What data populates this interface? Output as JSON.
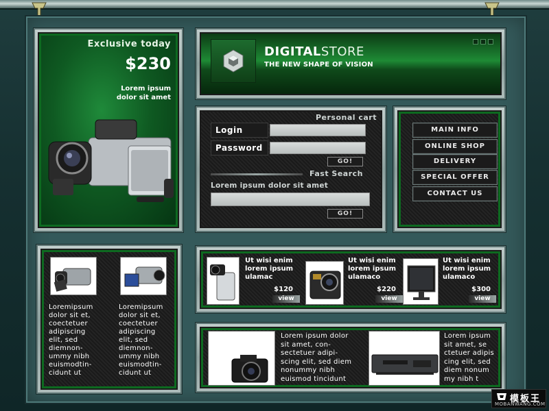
{
  "promo": {
    "title": "Exclusive today",
    "price": "$230",
    "desc_line1": "Lorem ipsum",
    "desc_line2": "dolor sit amet"
  },
  "header": {
    "brand_bold": "DIGITAL",
    "brand_light": "STORE",
    "tagline": "THE NEW SHAPE OF  VISION"
  },
  "cart": {
    "caption": "Personal cart",
    "login_label": "Login",
    "password_label": "Password",
    "login_value": "",
    "password_value": "",
    "go_label": "GO!"
  },
  "search": {
    "caption": "Fast Search",
    "prompt": "Lorem ipsum dolor sit amet",
    "value": "",
    "go_label": "GO!"
  },
  "menu": {
    "items": [
      {
        "label": "MAIN INFO"
      },
      {
        "label": "ONLINE SHOP"
      },
      {
        "label": "DELIVERY"
      },
      {
        "label": "SPECIAL OFFER"
      },
      {
        "label": "CONTACT US"
      }
    ]
  },
  "left_products": [
    {
      "text_lines": [
        "Loremipsum",
        "dolor sit et,",
        "coectetuer",
        "adipiscing",
        "elit, sed",
        "diemnon-",
        "ummy nibh",
        "euismodtin-",
        "cidunt ut"
      ]
    },
    {
      "text_lines": [
        "Loremipsum",
        "dolor sit et,",
        "coectetuer",
        "adipiscing",
        "elit, sed",
        "diemnon-",
        "ummy nibh",
        "euismodtin-",
        "cidunt ut"
      ]
    }
  ],
  "featured": [
    {
      "title_lines": [
        "Ut wisi enim",
        "lorem ipsum",
        "ulamac"
      ],
      "price": "$120",
      "view_label": "view"
    },
    {
      "title_lines": [
        "Ut wisi enim",
        "lorem ipsum",
        "ulamaco"
      ],
      "price": "$220",
      "view_label": "view"
    },
    {
      "title_lines": [
        "Ut wisi enim",
        "lorem ipsum",
        "ulamaco"
      ],
      "price": "$300",
      "view_label": "view"
    }
  ],
  "bottom": {
    "text1_lines": [
      "Lorem ipsum dolor",
      "sit amet, con-",
      "sectetuer adipi-",
      "scing elit, sed diem",
      "nonummy nibh",
      "euismod tincidunt"
    ],
    "text2_lines": [
      "Lorem ipsum",
      " sit amet, se",
      "ctetuer adipis",
      "cing elit, sed",
      "diem nonum",
      "my nibh t"
    ]
  },
  "watermark": {
    "cn": "模板王",
    "en": "MOBANWANG.COM"
  },
  "colors": {
    "accent_green": "#1f8a3a",
    "frame_teal": "#34595a",
    "panel_dark": "#1a1a1a"
  }
}
